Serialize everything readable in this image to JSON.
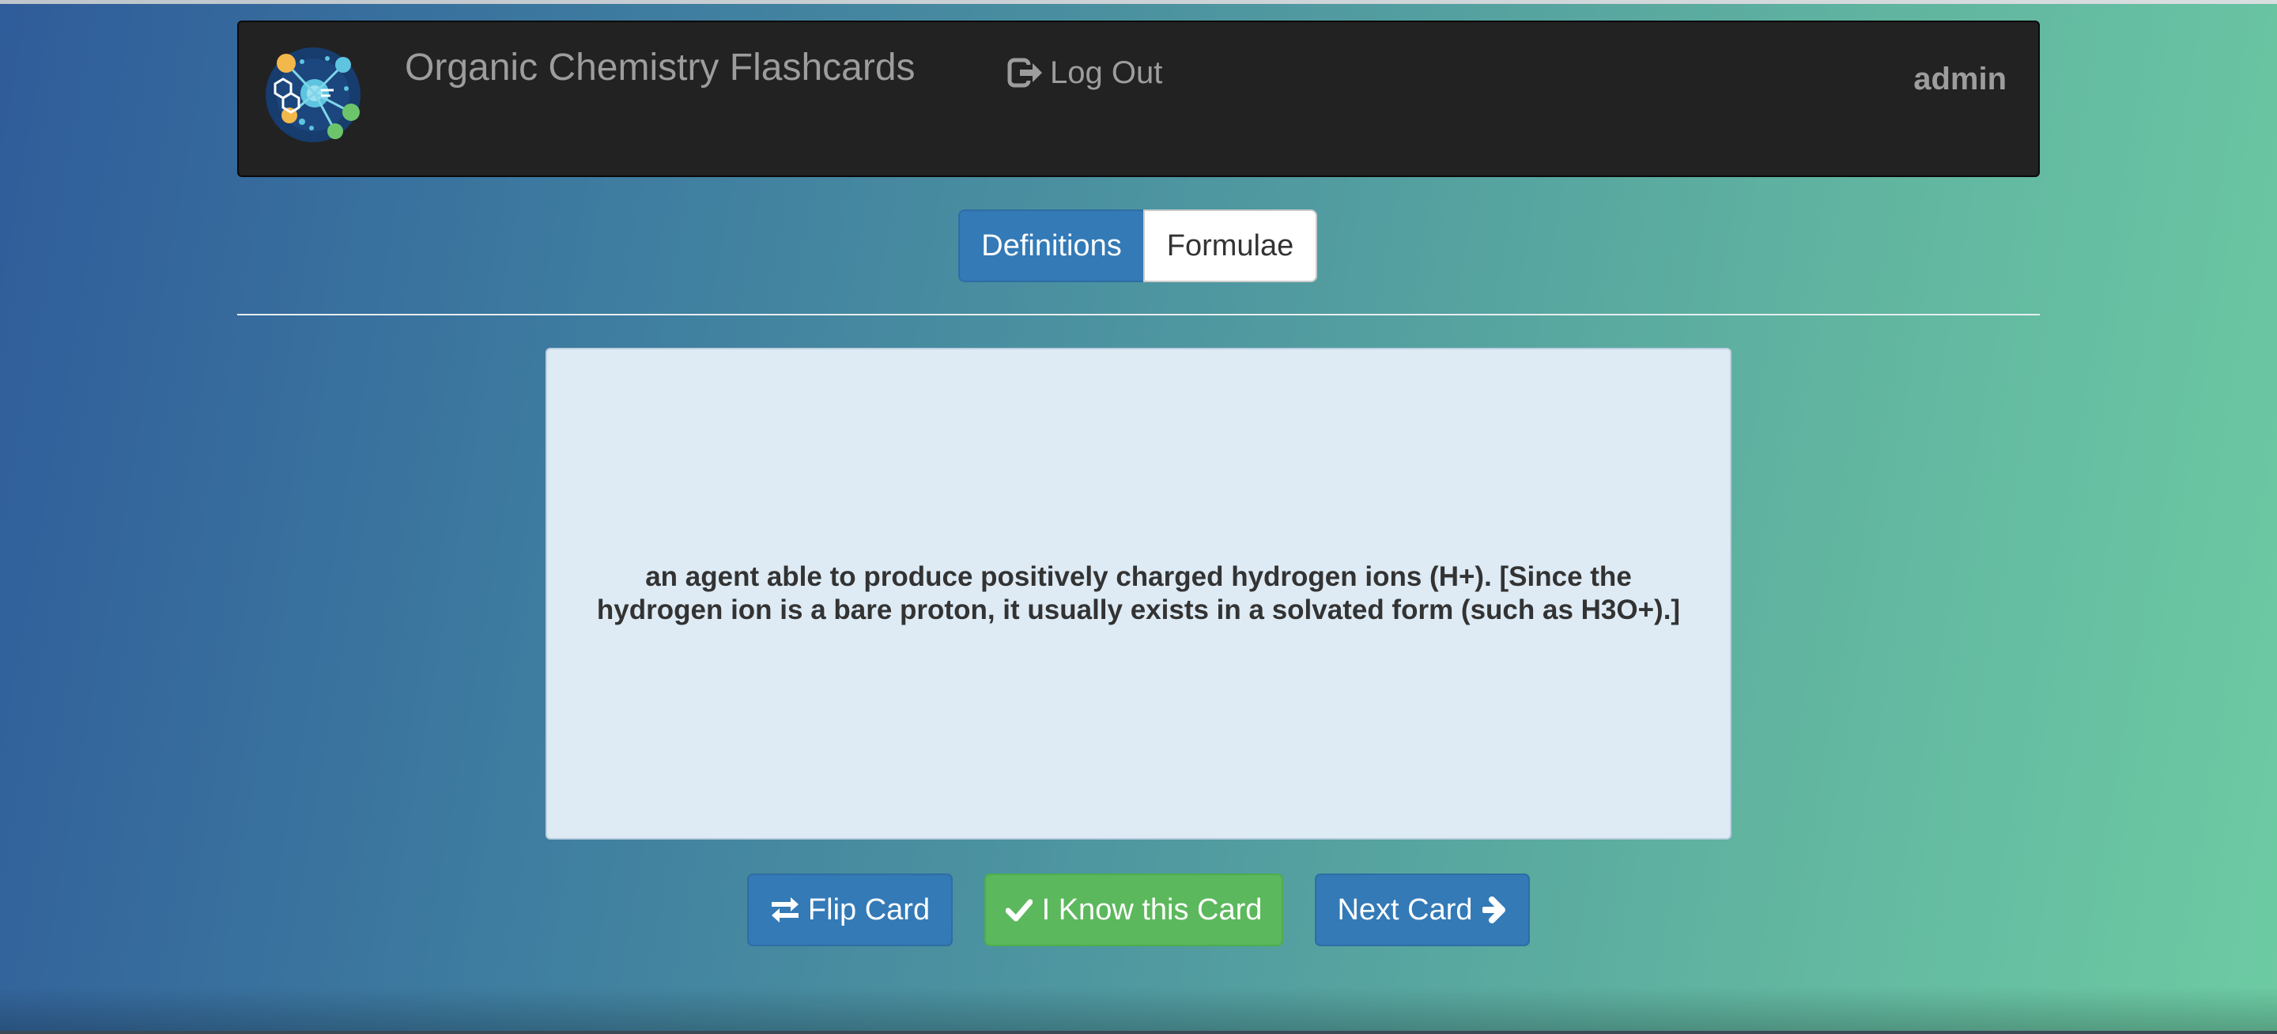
{
  "app": {
    "title": "Organic Chemistry Flashcards",
    "logo_icon": "molecule-logo"
  },
  "navbar": {
    "logout_label": "Log Out",
    "logout_icon": "sign-out-icon",
    "username": "admin"
  },
  "tabs": [
    {
      "label": "Definitions",
      "active": true
    },
    {
      "label": "Formulae",
      "active": false
    }
  ],
  "card": {
    "text": "an agent able to produce positively charged hydrogen ions (H+). [Since the hydrogen ion is a bare proton, it usually exists in a solvated form (such as H3O+).]"
  },
  "actions": {
    "flip_label": "Flip Card",
    "flip_icon": "swap-arrows-icon",
    "know_label": "I Know this Card",
    "know_icon": "check-icon",
    "next_label": "Next Card",
    "next_icon": "arrow-right-icon"
  },
  "colors": {
    "navbar": "#222222",
    "primary": "#337ab7",
    "success": "#5cb85c",
    "card_bg": "#deebf5"
  }
}
